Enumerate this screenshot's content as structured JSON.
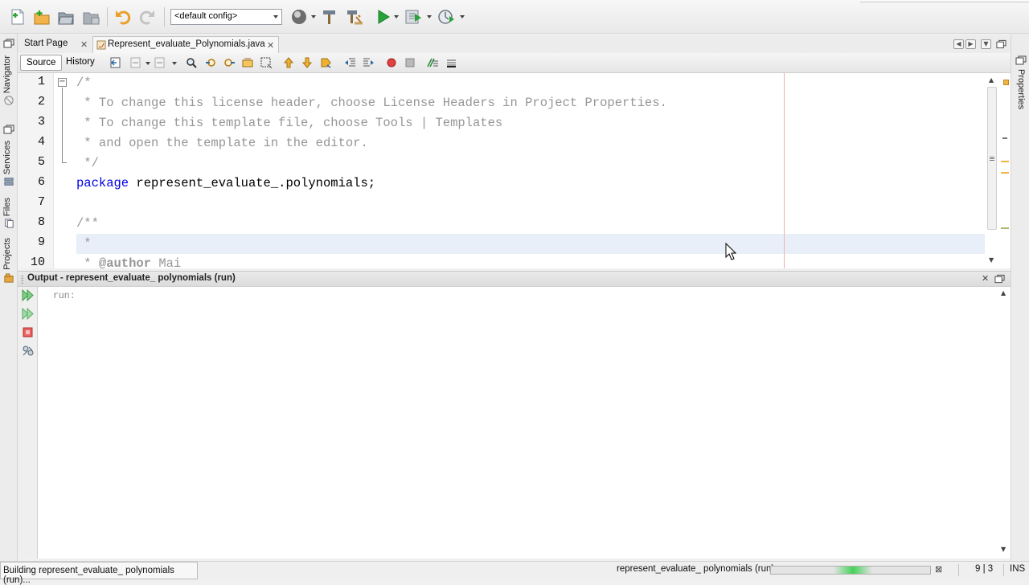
{
  "toolbar": {
    "config_value": "<default config>",
    "icons": [
      "new-file-icon",
      "new-project-icon",
      "open-project-icon",
      "close-project-icon",
      "undo-icon",
      "redo-icon",
      "config-combo",
      "build-globe-icon",
      "build-hammer-icon",
      "clean-build-icon",
      "run-icon",
      "debug-icon",
      "profile-icon"
    ]
  },
  "left_panel": {
    "tabs": [
      "Navigator",
      "Services",
      "Files",
      "Projects"
    ]
  },
  "right_panel": {
    "tabs": [
      "Properties"
    ]
  },
  "editor": {
    "tabs": [
      {
        "label": "Start Page",
        "active": false
      },
      {
        "label": "Represent_evaluate_Polynomials.java",
        "active": true
      }
    ],
    "modes": {
      "source": "Source",
      "history": "History"
    },
    "line_numbers": [
      "1",
      "2",
      "3",
      "4",
      "5",
      "6",
      "7",
      "8",
      "9",
      "10"
    ],
    "lines": {
      "l1": "/*",
      "l2": " * To change this license header, choose License Headers in Project Properties.",
      "l3": " * To change this template file, choose Tools | Templates",
      "l4": " * and open the template in the editor.",
      "l5": " */",
      "l6_kw": "package",
      "l6_rest": " represent_evaluate_.polynomials;",
      "l7": "",
      "l8": "/**",
      "l9": " *",
      "l10_pre": " * ",
      "l10_tag": "@author",
      "l10_rest": " Mai"
    },
    "current_line": 9
  },
  "output": {
    "title": "Output - represent_evaluate_ polynomials (run)",
    "text": "run:"
  },
  "status": {
    "message": "Building represent_evaluate_ polynomials (run)...",
    "task": "represent_evaluate_ polynomials (run)",
    "progress_note": "indeterminate",
    "position": "9 | 3",
    "insert_mode": "INS"
  },
  "colors": {
    "keyword": "#0000e6",
    "comment": "#969696",
    "current_line": "#e9eff8",
    "margin_line": "#f0b0b0",
    "progress_glow": "#46d15a"
  }
}
